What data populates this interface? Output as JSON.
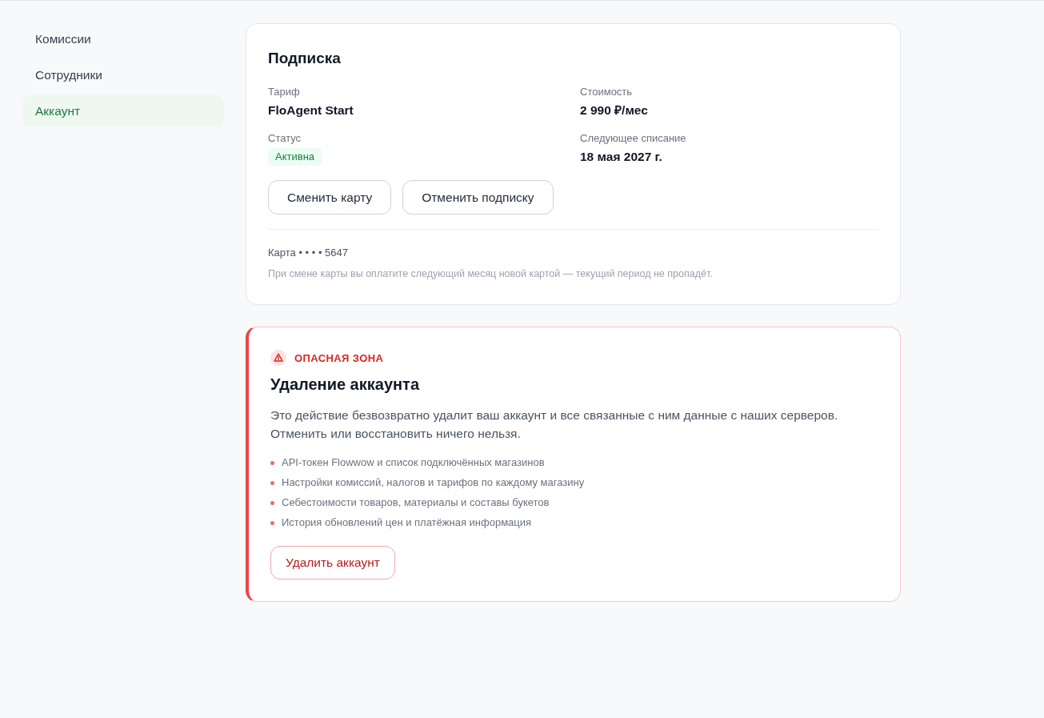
{
  "sidebar": {
    "items": [
      {
        "label": "Комиссии",
        "selected": false
      },
      {
        "label": "Сотрудники",
        "selected": false
      },
      {
        "label": "Аккаунт",
        "selected": true
      }
    ]
  },
  "subscription": {
    "title": "Подписка",
    "fields": [
      {
        "label": "Тариф",
        "value": "FloAgent Start",
        "kind": "text"
      },
      {
        "label": "Стоимость",
        "value": "2 990 ₽/мес",
        "kind": "text"
      },
      {
        "label": "Статус",
        "value": "Активна",
        "kind": "badge"
      },
      {
        "label": "Следующее списание",
        "value": "18 мая 2027 г.",
        "kind": "text"
      }
    ],
    "buttons": [
      "Сменить карту",
      "Отменить подписку"
    ],
    "card": "Карта • • • • 5647",
    "note": "При смене карты вы оплатите следующий месяц новой картой — текущий период не пропадёт."
  },
  "danger_zone": {
    "label": "ОПАСНАЯ ЗОНА",
    "title": "Удаление аккаунта",
    "description": "Это действие безвозвратно удалит ваш аккаунт и все связанные с ним данные с наших серверов. Отменить или восстановить ничего нельзя.",
    "items": [
      "API-токен Flowwow и список подключённых магазинов",
      "Настройки комиссий, налогов и тарифов по каждому магазину",
      "Себестоимости товаров, материалы и составы букетов",
      "История обновлений цен и платёжная информация"
    ],
    "button": "Удалить аккаунт"
  }
}
